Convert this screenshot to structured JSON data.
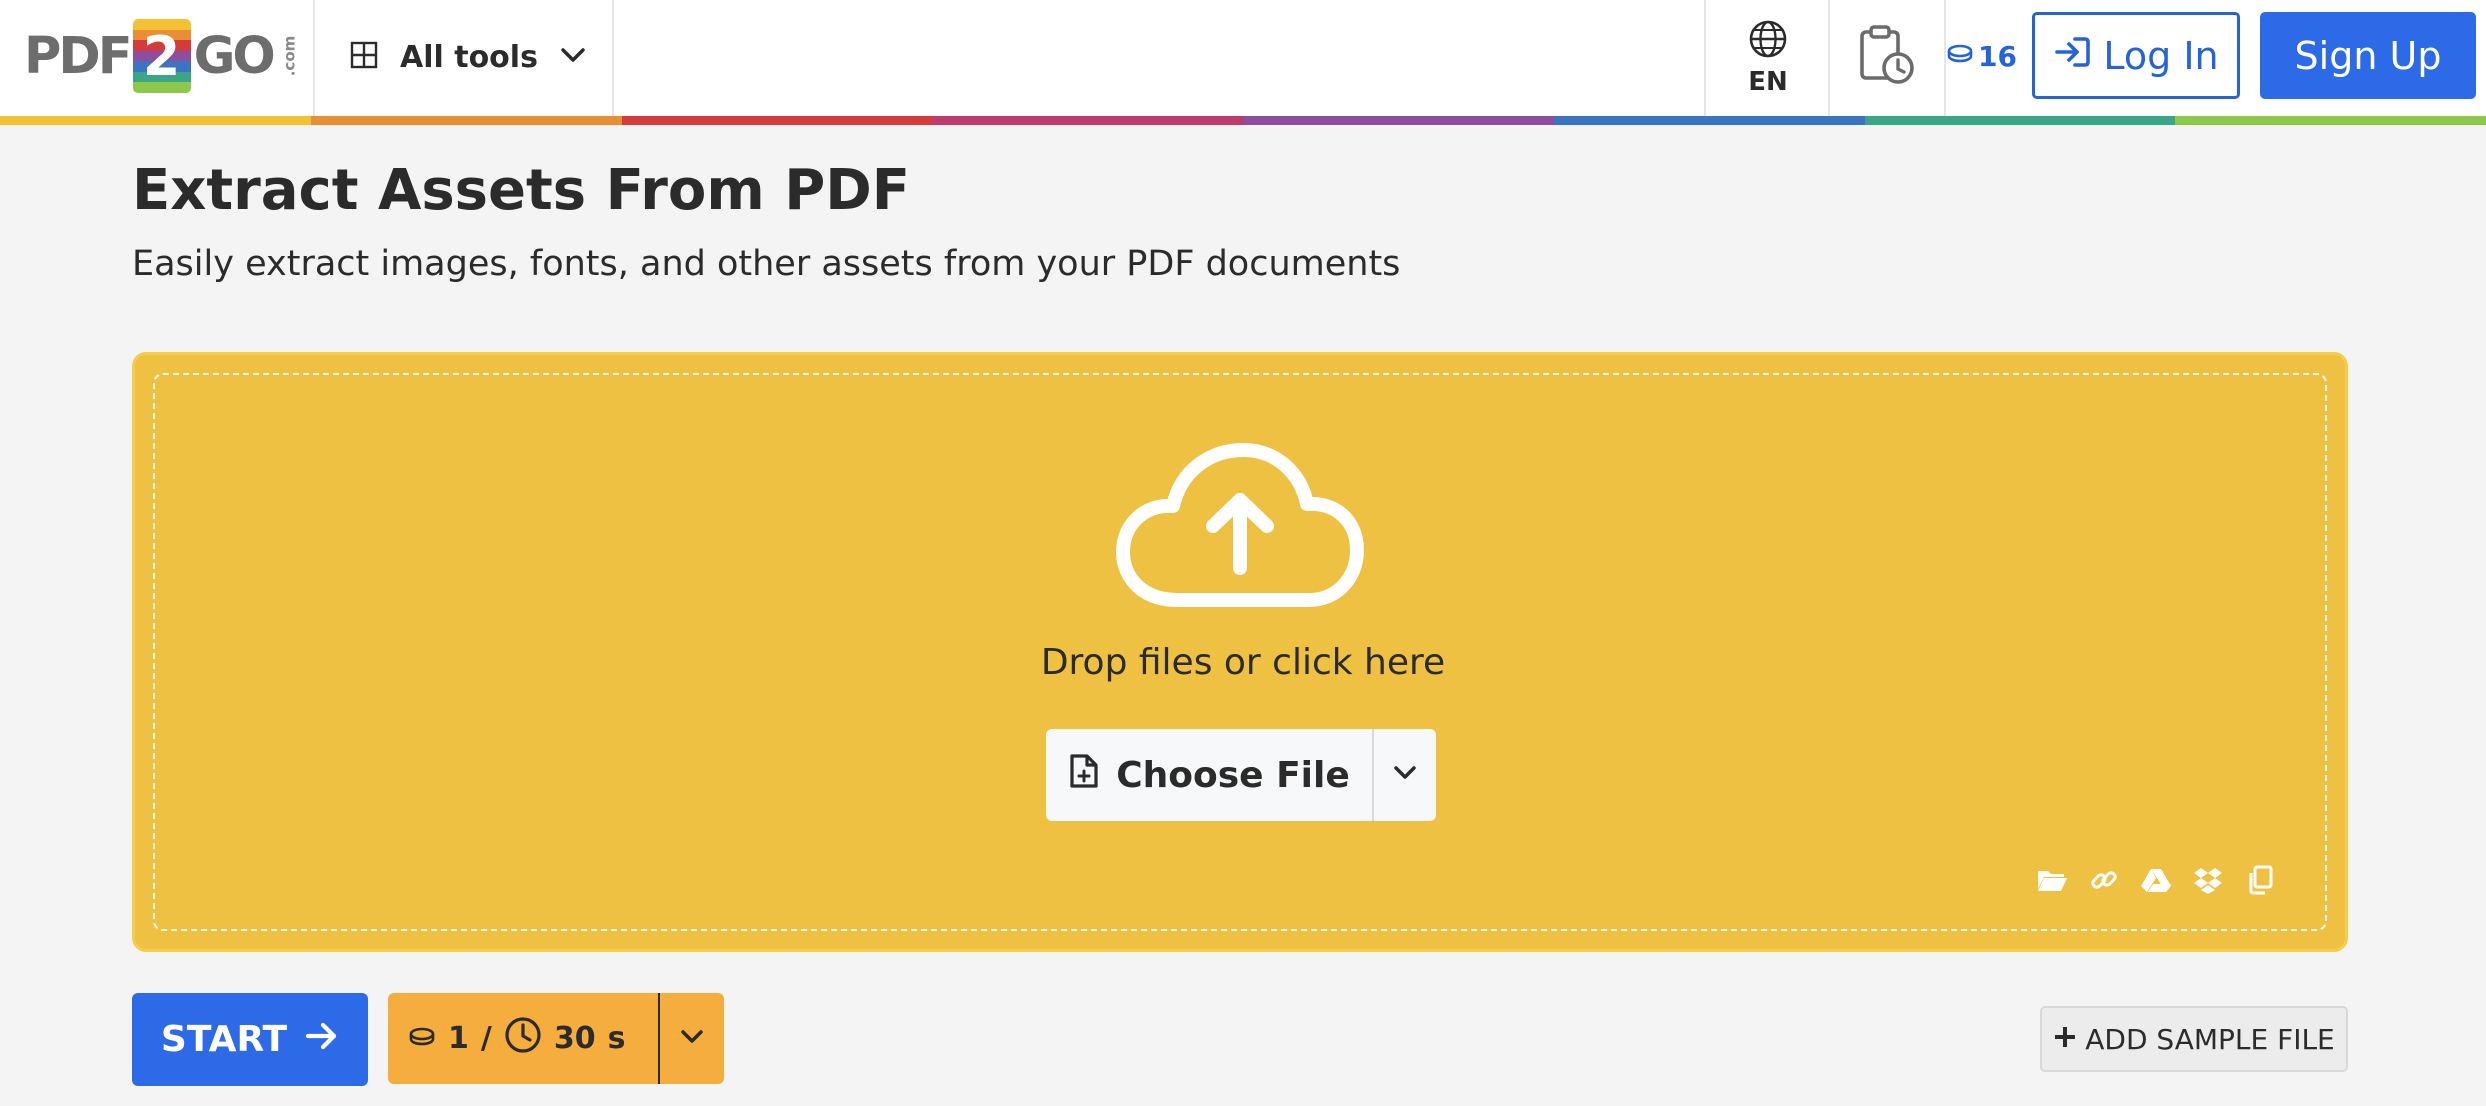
{
  "header": {
    "logo": {
      "left": "PDF",
      "digit": "2",
      "right": "GO",
      "suffix": ".com"
    },
    "all_tools_label": "All tools",
    "language_code": "EN",
    "credits_count": "16",
    "login_label": "Log In",
    "signup_label": "Sign Up",
    "rainbow_colors": [
      "#f2c233",
      "#e88e35",
      "#d63b3b",
      "#c03b6d",
      "#8d4ea0",
      "#3b74c2",
      "#3aa685",
      "#8cc94a"
    ]
  },
  "main": {
    "title": "Extract Assets From PDF",
    "subtitle": "Easily extract images, fonts, and other assets from your PDF documents",
    "dropzone": {
      "prompt": "Drop files or click here",
      "choose_file_label": "Choose File",
      "source_icons": [
        "folder-icon",
        "link-icon",
        "google-drive-icon",
        "dropbox-icon",
        "clipboard-icon"
      ]
    },
    "actions": {
      "start_label": "START",
      "cost_credits": "1",
      "cost_separator": "/",
      "cost_time": "30",
      "cost_time_unit": "s",
      "add_sample_label": "ADD SAMPLE FILE"
    }
  },
  "colors": {
    "accent_blue": "#2d6ae8",
    "dropzone_yellow": "#efc142",
    "cost_orange": "#f5ae3e"
  }
}
